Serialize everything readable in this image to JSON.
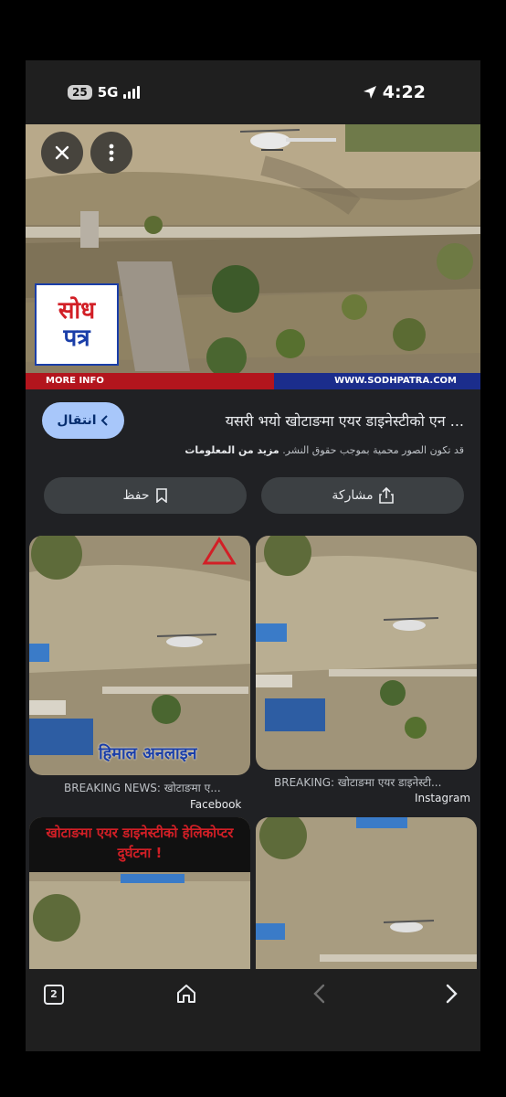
{
  "status_bar": {
    "battery": "25",
    "network": "5G",
    "time": "4:22"
  },
  "hero": {
    "logo_line1": "सोध",
    "logo_line2": "पत्र",
    "ticker_left": "MORE INFO",
    "ticker_right": "WWW.SODHPATRA.COM"
  },
  "result": {
    "visit_label": "انتقال",
    "title": "यसरी भयो खोटाङमा एयर डाइनेस्टीको एन ...",
    "copyright_text": "قد تكون الصور محمية بموجب حقوق النشر.",
    "more_info": "مزيد من المعلومات",
    "save_label": "حفظ",
    "share_label": "مشاركة"
  },
  "related": [
    {
      "caption": "BREAKING NEWS: खोटाङमा ए...",
      "source": "Facebook",
      "overlay": "हिमाल अनलाइन"
    },
    {
      "caption": "BREAKING: खोटाङमा एयर डाइनेस्टी...",
      "source": "Instagram"
    },
    {
      "overlay": "खोटाङमा एयर डाइनेस्टीको हेलिकोप्टर दुर्घटना !"
    },
    {}
  ],
  "bottom_nav": {
    "tab_count": "2"
  }
}
